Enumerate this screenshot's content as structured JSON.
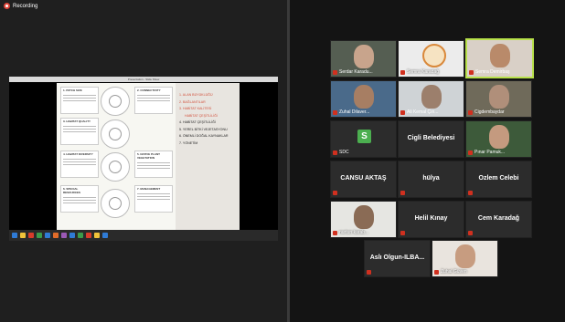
{
  "recording_label": "Recording",
  "screen_share": {
    "window_title": "Presentation - Slide Show",
    "cards": [
      "1. PATCH SIZE",
      "2. CONNECTIVITY",
      "3. HABITAT QUALITY",
      "4. HABITAT DIVERSITY",
      "5. NATIVE PLANT VEGETATION",
      "6. SPECIAL RESOURCES",
      "7. MANAGEMENT"
    ],
    "list_items": [
      {
        "text": "1. ALAN BÜYÜKLÜĞÜ",
        "style": "red"
      },
      {
        "text": "2. BAĞLANTILAR",
        "style": "red"
      },
      {
        "text": "3. HABİTAT KALİTESİ",
        "style": "red"
      },
      {
        "text": "HABİTAT ÇEŞİTLİLİĞİ",
        "style": "red"
      },
      {
        "text": "4. HABİTAT ÇEŞİTLİLİĞİ",
        "style": "dark"
      },
      {
        "text": "5. YEREL BİTKİ VEJETASYONU",
        "style": "dark"
      },
      {
        "text": "6. ÖNEMLİ DOĞAL KAYNAKLAR",
        "style": "dark"
      },
      {
        "text": "7. YÖNETİM",
        "style": "dark"
      }
    ]
  },
  "participants": [
    {
      "name": "Serdar Karadu...",
      "type": "video",
      "active": false,
      "muted": true
    },
    {
      "name": "Semra Karadağ",
      "type": "logo",
      "active": false,
      "muted": true
    },
    {
      "name": "Semra Demirbaş",
      "type": "video",
      "active": true,
      "muted": true
    },
    {
      "name": "Zuhal Dilaver...",
      "type": "video",
      "active": false,
      "muted": true
    },
    {
      "name": "Ali Kemal Çın...",
      "type": "video",
      "active": false,
      "muted": true
    },
    {
      "name": "Cigdembaydar",
      "type": "video",
      "active": false,
      "muted": true
    },
    {
      "name": "SDC",
      "type": "avatar",
      "letter": "S",
      "active": false,
      "muted": true
    },
    {
      "name": "Cigli Belediyesi",
      "type": "text",
      "active": false,
      "muted": false
    },
    {
      "name": "Pınar Pamuk...",
      "type": "video",
      "active": false,
      "muted": true
    },
    {
      "name": "CANSU AKTAŞ",
      "type": "text",
      "active": false,
      "muted": true
    },
    {
      "name": "hülya",
      "type": "text",
      "active": false,
      "muted": true
    },
    {
      "name": "Ozlem Celebi",
      "type": "text",
      "active": false,
      "muted": true
    },
    {
      "name": "nurtun karab...",
      "type": "video",
      "active": false,
      "muted": true
    },
    {
      "name": "Helil Kınay",
      "type": "text",
      "active": false,
      "muted": true
    },
    {
      "name": "Cem Karadağ",
      "type": "text",
      "active": false,
      "muted": true
    },
    {
      "name": "Aslı Olgun-ILBA...",
      "type": "text",
      "active": false,
      "muted": true
    },
    {
      "name": "Zuhal Güven",
      "type": "video",
      "active": false,
      "muted": true
    }
  ],
  "colors": {
    "active_border": "#b7e04a",
    "mute_red": "#d0301f",
    "avatar_green": "#4caf50"
  }
}
